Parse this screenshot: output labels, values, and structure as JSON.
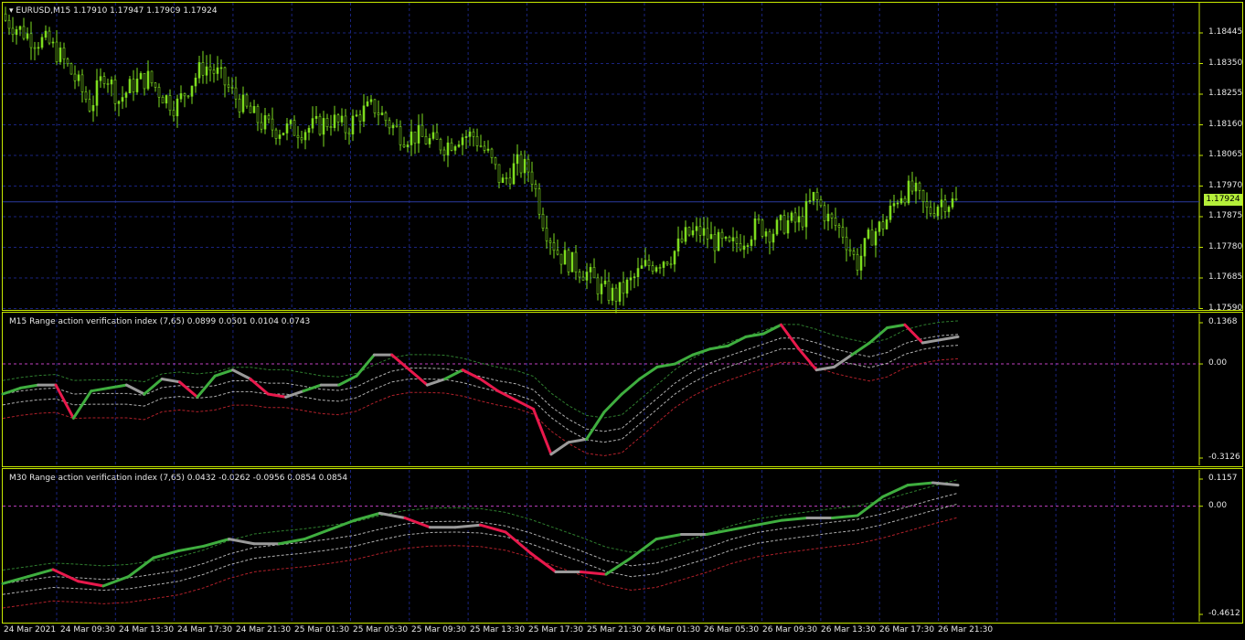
{
  "colors": {
    "frame": "#c7e800",
    "grid": "#1a237e",
    "bull": "#7ddc1f",
    "bear": "#7ddc1f",
    "green": "#3fae3f",
    "red": "#e8194c",
    "gray": "#9a9a9a",
    "dash_green": "#2f7f2f",
    "dash_gray": "#b0b0b0",
    "dash_red": "#b0202a",
    "zero": "#c040c0",
    "price_box": "#b5ef3a"
  },
  "main": {
    "title": "EURUSD,M15  1.17910 1.17947 1.17909 1.17924",
    "current_price": "1.17924",
    "y_labels": [
      "1.18445",
      "1.18350",
      "1.18255",
      "1.18160",
      "1.18065",
      "1.17970",
      "1.17875",
      "1.17780",
      "1.17685",
      "1.17590"
    ]
  },
  "ind1": {
    "title": "M15 Range action verification index (7,65) 0.0899 0.0501 0.0104 0.0743",
    "y_labels": [
      "0.1368",
      "0.00",
      "-0.3126"
    ]
  },
  "ind2": {
    "title": "M30 Range action verification index (7,65) 0.0432 -0.0262 -0.0956 0.0854 0.0854",
    "y_labels": [
      "0.1157",
      "0.00",
      "-0.4612"
    ]
  },
  "x_labels": [
    "24 Mar 2021",
    "24 Mar 09:30",
    "24 Mar 13:30",
    "24 Mar 17:30",
    "24 Mar 21:30",
    "25 Mar 01:30",
    "25 Mar 05:30",
    "25 Mar 09:30",
    "25 Mar 13:30",
    "25 Mar 17:30",
    "25 Mar 21:30",
    "26 Mar 01:30",
    "26 Mar 05:30",
    "26 Mar 09:30",
    "26 Mar 13:30",
    "26 Mar 17:30",
    "26 Mar 21:30"
  ],
  "chart_data": [
    {
      "type": "candlestick",
      "title": "EURUSD,M15  1.17910 1.17947 1.17909 1.17924",
      "ylim": [
        1.1759,
        1.1849
      ],
      "close_trace": [
        1.1849,
        1.1846,
        1.1843,
        1.1842,
        1.1837,
        1.183,
        1.1822,
        1.1833,
        1.1824,
        1.1829,
        1.1831,
        1.1826,
        1.1822,
        1.1829,
        1.1835,
        1.1832,
        1.1826,
        1.1821,
        1.1817,
        1.1815,
        1.1815,
        1.1815,
        1.1816,
        1.1818,
        1.1815,
        1.182,
        1.1822,
        1.1817,
        1.1813,
        1.1813,
        1.1811,
        1.181,
        1.1813,
        1.1813,
        1.1807,
        1.1798,
        1.1804,
        1.1802,
        1.1785,
        1.1776,
        1.1773,
        1.177,
        1.1765,
        1.1763,
        1.1767,
        1.1772,
        1.1774,
        1.1776,
        1.1782,
        1.1783,
        1.178,
        1.1778,
        1.1781,
        1.1785,
        1.1783,
        1.1786,
        1.1786,
        1.1794,
        1.1787,
        1.1783,
        1.1773,
        1.1782,
        1.1786,
        1.1795,
        1.1796,
        1.1789,
        1.1793,
        1.1792
      ]
    },
    {
      "type": "line",
      "title": "M15 Range action verification index (7,65) 0.0899 0.0501 0.0104 0.0743",
      "ylim": [
        -0.3126,
        0.1368
      ],
      "series": [
        {
          "values": [
            -0.1,
            -0.08,
            -0.07,
            -0.07,
            -0.18,
            -0.09,
            -0.08,
            -0.07,
            -0.1,
            -0.05,
            -0.06,
            -0.11,
            -0.04,
            -0.02,
            -0.05,
            -0.1,
            -0.11,
            -0.09,
            -0.07,
            -0.07,
            -0.04,
            0.03,
            0.03,
            -0.02,
            -0.07,
            -0.05,
            -0.02,
            -0.05,
            -0.09,
            -0.12,
            -0.15,
            -0.3,
            -0.26,
            -0.25,
            -0.16,
            -0.1,
            -0.05,
            -0.01,
            0.0,
            0.03,
            0.05,
            0.06,
            0.09,
            0.1,
            0.13,
            0.05,
            -0.02,
            -0.01,
            0.03,
            0.07,
            0.12,
            0.13,
            0.07,
            0.08,
            0.09
          ]
        }
      ]
    },
    {
      "type": "line",
      "title": "M30 Range action verification index (7,65) 0.0432 -0.0262 -0.0956 0.0854 0.0854",
      "ylim": [
        -0.4612,
        0.1157
      ],
      "series": [
        {
          "values": [
            -0.33,
            -0.3,
            -0.27,
            -0.32,
            -0.34,
            -0.3,
            -0.22,
            -0.19,
            -0.17,
            -0.14,
            -0.16,
            -0.16,
            -0.14,
            -0.1,
            -0.06,
            -0.03,
            -0.05,
            -0.09,
            -0.09,
            -0.08,
            -0.11,
            -0.2,
            -0.28,
            -0.28,
            -0.29,
            -0.22,
            -0.14,
            -0.12,
            -0.12,
            -0.1,
            -0.08,
            -0.06,
            -0.05,
            -0.05,
            -0.04,
            0.04,
            0.09,
            0.1,
            0.09
          ]
        }
      ]
    }
  ]
}
